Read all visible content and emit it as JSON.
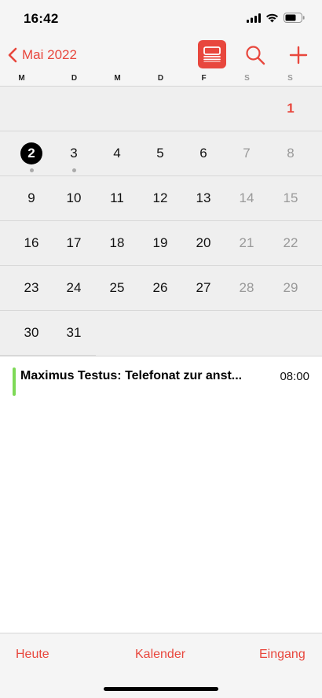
{
  "status_bar": {
    "time": "16:42"
  },
  "nav": {
    "back_label": "Mai 2022"
  },
  "weekdays": [
    "M",
    "D",
    "M",
    "D",
    "F",
    "S",
    "S"
  ],
  "weeks": [
    [
      "",
      "",
      "",
      "",
      "",
      "",
      "1"
    ],
    [
      "2",
      "3",
      "4",
      "5",
      "6",
      "7",
      "8"
    ],
    [
      "9",
      "10",
      "11",
      "12",
      "13",
      "14",
      "15"
    ],
    [
      "16",
      "17",
      "18",
      "19",
      "20",
      "21",
      "22"
    ],
    [
      "23",
      "24",
      "25",
      "26",
      "27",
      "28",
      "29"
    ],
    [
      "30",
      "31",
      "",
      "",
      "",
      "",
      ""
    ]
  ],
  "events": [
    {
      "title": "Maximus Testus: Telefonat zur anst...",
      "time": "08:00",
      "color": "#7ed957"
    }
  ],
  "tabs": {
    "today": "Heute",
    "calendars": "Kalender",
    "inbox": "Eingang"
  },
  "colors": {
    "accent": "#e8473d"
  }
}
